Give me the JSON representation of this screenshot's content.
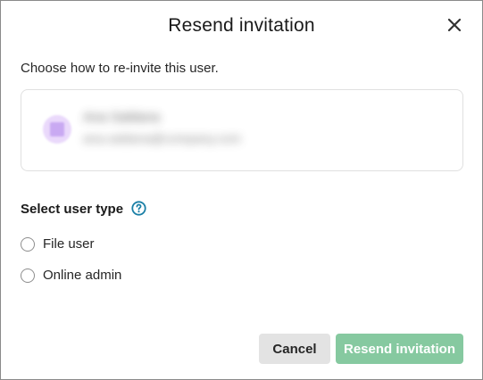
{
  "dialog": {
    "title": "Resend invitation",
    "close_icon": "close-icon",
    "intro": "Choose how to re-invite this user."
  },
  "user_card": {
    "avatar_icon": "user-avatar",
    "name": "Ana Saldana",
    "email": "ana.saldana@company.com"
  },
  "user_type": {
    "label": "Select user type",
    "help_icon": "question-circle-icon",
    "options": [
      {
        "label": "File user",
        "selected": false
      },
      {
        "label": "Online admin",
        "selected": false
      }
    ]
  },
  "footer": {
    "cancel_label": "Cancel",
    "submit_label": "Resend invitation"
  },
  "colors": {
    "primary_disabled": "#86c9a0",
    "help_icon": "#1a7fa6",
    "cancel_bg": "#e3e3e3"
  }
}
